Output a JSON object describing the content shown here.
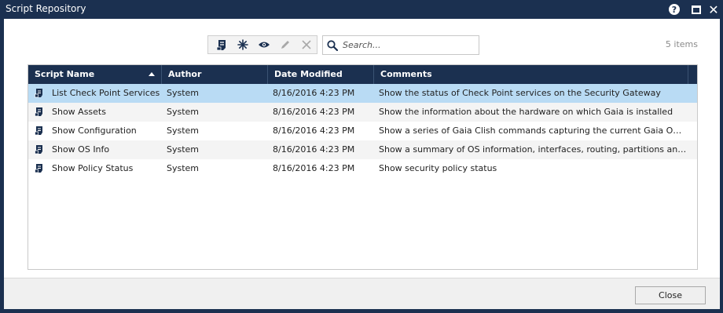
{
  "window": {
    "title": "Script Repository",
    "help_label": "?",
    "close_glyph": "✕"
  },
  "toolbar": {
    "icons": [
      "script-run-icon",
      "new-icon",
      "view-icon",
      "edit-icon",
      "delete-icon"
    ],
    "search": {
      "placeholder": "Search...",
      "value": ""
    },
    "items_count": "5 items"
  },
  "table": {
    "columns": [
      "Script Name",
      "Author",
      "Date Modified",
      "Comments"
    ],
    "sort_column": "Script Name",
    "sort_direction": "ascending",
    "rows": [
      {
        "name": "List Check Point Services",
        "author": "System",
        "date": "8/16/2016 4:23 PM",
        "comments": "Show the status of Check Point services on the Security Gateway",
        "selected": true
      },
      {
        "name": "Show Assets",
        "author": "System",
        "date": "8/16/2016 4:23 PM",
        "comments": "Show the information about the hardware on which Gaia is installed"
      },
      {
        "name": "Show Configuration",
        "author": "System",
        "date": "8/16/2016 4:23 PM",
        "comments": "Show a series of Gaia Clish commands capturing the current Gaia OS conf..."
      },
      {
        "name": "Show OS Info",
        "author": "System",
        "date": "8/16/2016 4:23 PM",
        "comments": "Show a summary of OS information, interfaces, routing, partitions and CP..."
      },
      {
        "name": "Show Policy Status",
        "author": "System",
        "date": "8/16/2016 4:23 PM",
        "comments": "Show security policy status"
      }
    ]
  },
  "footer": {
    "close_label": "Close"
  },
  "colors": {
    "titlebar": "#1b3050",
    "header": "#1b3050",
    "selected_row": "#b9dbf4",
    "alt_row": "#f4f4f4"
  }
}
